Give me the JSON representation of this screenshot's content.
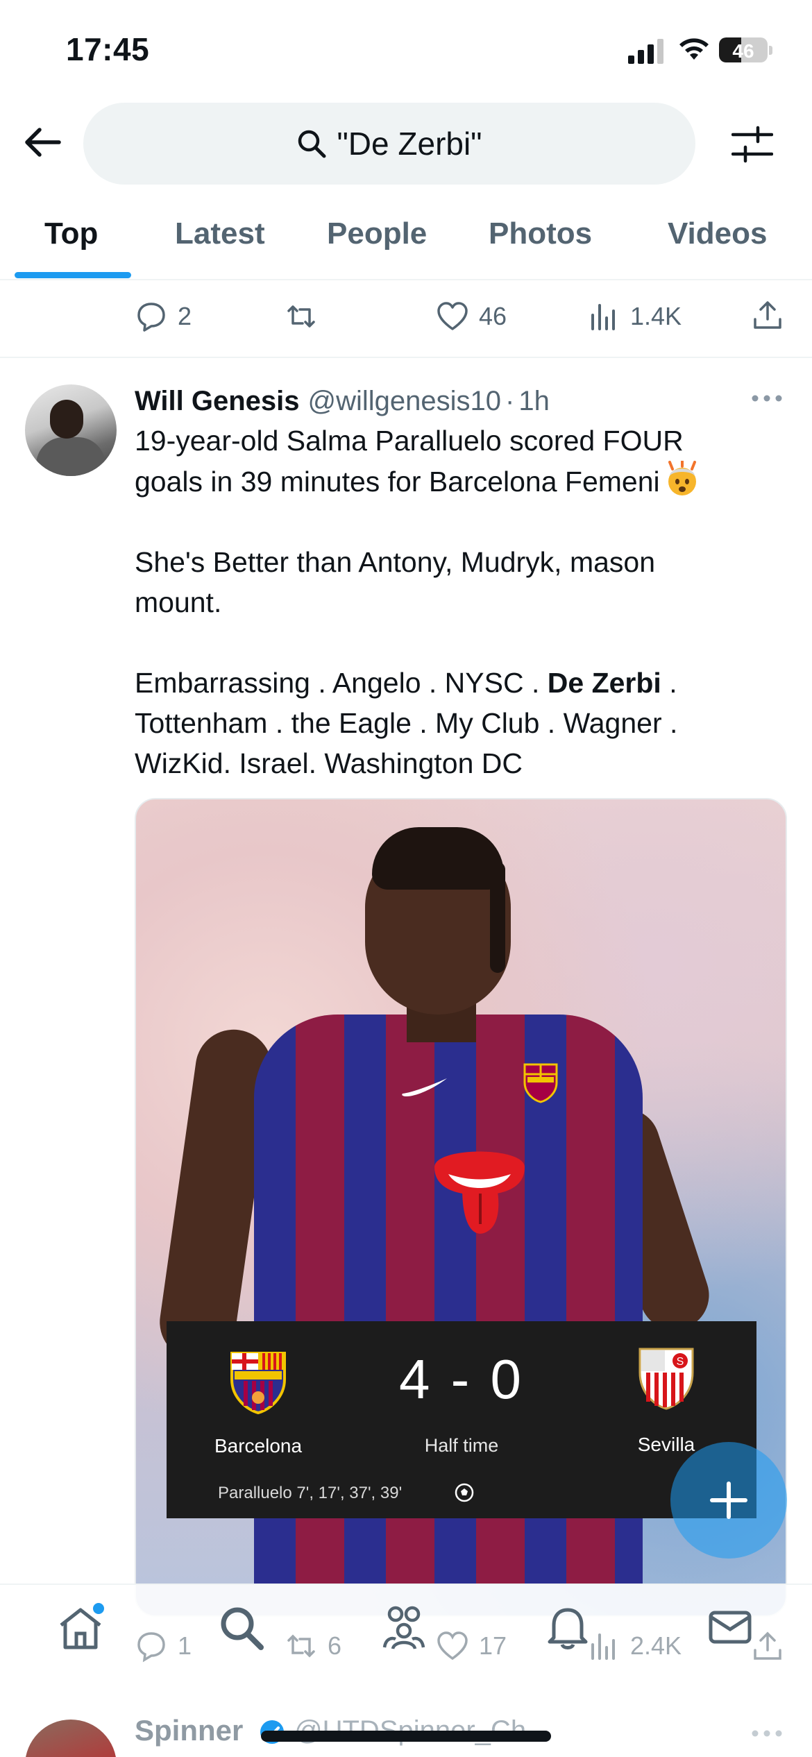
{
  "status_bar": {
    "time": "17:45",
    "battery_level": "46",
    "battery_fraction": 0.46
  },
  "search": {
    "query": "\"De Zerbi\""
  },
  "tabs": [
    {
      "label": "Top",
      "active": true
    },
    {
      "label": "Latest",
      "active": false
    },
    {
      "label": "People",
      "active": false
    },
    {
      "label": "Photos",
      "active": false
    },
    {
      "label": "Videos",
      "active": false
    }
  ],
  "previous_tweet_actions": {
    "replies": "2",
    "likes": "46",
    "views": "1.4K"
  },
  "tweet": {
    "author_name": "Will Genesis",
    "author_handle": "@willgenesis10",
    "separator": "·",
    "time": "1h",
    "text": {
      "line1": "19-year-old Salma Paralluelo scored FOUR",
      "line2": "goals in 39 minutes for Barcelona Femeni",
      "emoji": "exploding-head-emoji",
      "line3": "She's Better than Antony, Mudryk, mason",
      "line4": "mount.",
      "line5_a": "Embarrassing . Angelo . NYSC . ",
      "line5_bold": "De Zerbi",
      "line5_b": " .",
      "line6": "Tottenham . the Eagle . My Club . Wagner .",
      "line7": "WizKid. Israel. Washington DC"
    },
    "scoreboard": {
      "home_team": "Barcelona",
      "away_team": "Sevilla",
      "score": "4 - 0",
      "status": "Half time",
      "scorers": "Paralluelo 7', 17', 37', 39'"
    },
    "actions": {
      "replies": "1",
      "retweets": "6",
      "likes": "17",
      "views": "2.4K"
    }
  },
  "next_tweet": {
    "author_name": "Spinner",
    "author_handle": "@UTDSpinner_Ch"
  },
  "colors": {
    "accent": "#1d9bf0",
    "text": "#0f1419",
    "muted": "#536471",
    "barca_blue": "#2b2e8f",
    "barca_red": "#8e1c44"
  }
}
